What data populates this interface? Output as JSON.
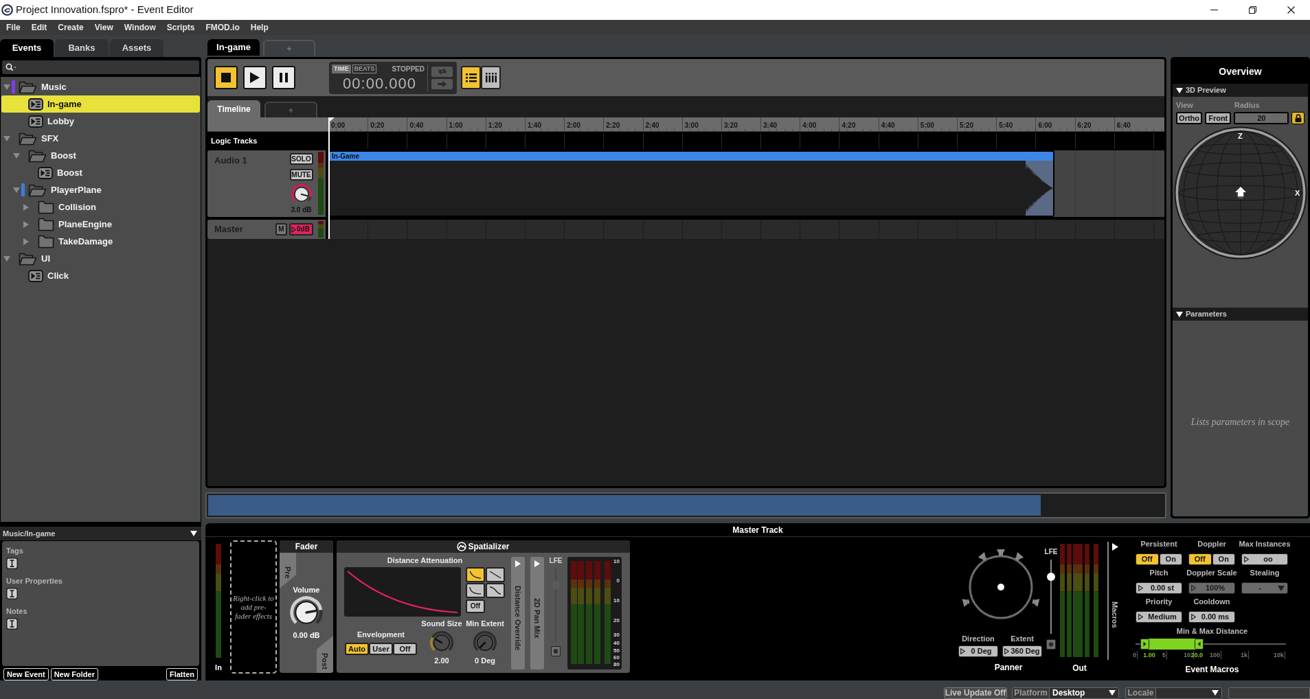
{
  "window": {
    "title": "Project Innovation.fspro* - Event Editor"
  },
  "menu": [
    "File",
    "Edit",
    "Create",
    "View",
    "Window",
    "Scripts",
    "FMOD.io",
    "Help"
  ],
  "browser": {
    "tabs": [
      {
        "label": "Events",
        "selected": true
      },
      {
        "label": "Banks",
        "selected": false
      },
      {
        "label": "Assets",
        "selected": false
      }
    ],
    "tree": [
      {
        "label": "Music",
        "kind": "folder",
        "expanded": true,
        "selected": false,
        "color": "#7c3fe6",
        "children": [
          {
            "label": "In-game",
            "kind": "event",
            "selected": true
          },
          {
            "label": "Lobby",
            "kind": "event",
            "selected": false
          }
        ]
      },
      {
        "label": "SFX",
        "kind": "folder",
        "expanded": true,
        "selected": false,
        "children": [
          {
            "label": "Boost",
            "kind": "folder",
            "expanded": true,
            "selected": false,
            "children": [
              {
                "label": "Boost",
                "kind": "event",
                "selected": false
              }
            ]
          },
          {
            "label": "PlayerPlane",
            "kind": "folder",
            "expanded": true,
            "selected": false,
            "color": "#3a7ce2",
            "children": [
              {
                "label": "Collision",
                "kind": "folder",
                "expanded": false,
                "selected": false
              },
              {
                "label": "PlaneEngine",
                "kind": "folder",
                "expanded": false,
                "selected": false
              },
              {
                "label": "TakeDamage",
                "kind": "folder",
                "expanded": false,
                "selected": false
              }
            ]
          }
        ]
      },
      {
        "label": "UI",
        "kind": "folder",
        "expanded": true,
        "selected": false,
        "children": [
          {
            "label": "Click",
            "kind": "event",
            "selected": false
          }
        ]
      }
    ],
    "inspector": {
      "path": "Music/In-game",
      "sections": [
        "Tags",
        "User Properties",
        "Notes"
      ]
    },
    "buttons": [
      "New Event",
      "New Folder"
    ],
    "flatten": "Flatten"
  },
  "editor": {
    "tabs": [
      {
        "label": "In-game",
        "selected": true
      },
      {
        "label": "+",
        "selected": false
      }
    ],
    "transport": [
      {
        "kind": "stop",
        "selected": true
      },
      {
        "kind": "play",
        "selected": false
      },
      {
        "kind": "pause",
        "selected": false
      }
    ],
    "time_modes": [
      {
        "label": "TIME",
        "selected": true
      },
      {
        "label": "BEATS",
        "selected": false
      }
    ],
    "play_state": "STOPPED",
    "time": "00:00.000",
    "view_modes": [
      {
        "kind": "list",
        "selected": true
      },
      {
        "kind": "grid",
        "selected": false
      }
    ],
    "sheet_tabs": [
      {
        "label": "Timeline",
        "selected": true
      },
      {
        "label": "+",
        "selected": false
      }
    ],
    "ruler": [
      "0:00",
      "0:20",
      "0:40",
      "1:00",
      "1:20",
      "1:40",
      "2:00",
      "2:20",
      "2:40",
      "3:00",
      "3:20",
      "3:40",
      "4:00",
      "4:20",
      "4:40",
      "5:00",
      "5:20",
      "5:40",
      "6:00",
      "6:20",
      "6:40"
    ],
    "logic_tracks": "Logic Tracks",
    "tracks": [
      {
        "kind": "audio",
        "name": "Audio 1",
        "solo": "SOLO",
        "mute": "MUTE",
        "volume": "3.0 dB",
        "instrument": "In-Game"
      },
      {
        "kind": "master",
        "name": "Master",
        "mute": "M",
        "volume": "0dB"
      }
    ]
  },
  "overview": {
    "title": "Overview",
    "preview": {
      "header": "3D Preview",
      "expanded": true,
      "view_label": "View",
      "view_buttons": [
        "Ortho",
        "Front"
      ],
      "radius_label": "Radius",
      "radius": "20",
      "locked": true,
      "axes": [
        "Z",
        "X"
      ]
    },
    "parameters": {
      "header": "Parameters",
      "expanded": true,
      "empty_text": "Lists parameters in scope"
    }
  },
  "deck": {
    "title": "Master Track",
    "input_label": "In",
    "effects_hint": "Right-click to add pre-fader effects",
    "fader": {
      "title": "Fader",
      "pre": "Pre",
      "post": "Post",
      "volume_label": "Volume",
      "volume": "0.00 dB"
    },
    "spatializer": {
      "title": "Spatializer",
      "attenuation_label": "Distance Attenuation",
      "curves": [
        {
          "kind": "logarithmic",
          "selected": true
        },
        {
          "kind": "linear",
          "selected": false
        },
        {
          "kind": "linear-squared",
          "selected": false
        },
        {
          "kind": "inverse-tapered",
          "selected": false
        }
      ],
      "curve_off": "Off",
      "envelopment_label": "Envelopment",
      "envelopment": [
        {
          "label": "Auto",
          "selected": true
        },
        {
          "label": "User",
          "selected": false
        },
        {
          "label": "Off",
          "selected": false
        }
      ],
      "sound_size_label": "Sound Size",
      "sound_size": "2.00",
      "min_extent_label": "Min Extent",
      "min_extent": "0 Deg",
      "side_tabs": [
        "Distance Override",
        "2D Pan Mix"
      ],
      "lfe": {
        "label": "LFE",
        "level": 0.8,
        "disabled": true
      },
      "meter_scale": [
        "10",
        "0",
        "10",
        "20",
        "30",
        "40",
        "50",
        "60",
        "80"
      ]
    },
    "panner": {
      "title": "Panner",
      "direction_label": "Direction",
      "direction": "0 Deg",
      "extent_label": "Extent",
      "extent": "360 Deg",
      "lfe": {
        "label": "LFE",
        "level": 0.8,
        "disabled": false
      }
    },
    "output_label": "Out",
    "macros_tab": "Macros",
    "macros": {
      "title": "Event Macros",
      "fields": [
        {
          "kind": "toggle",
          "label": "Persistent",
          "options": [
            {
              "label": "Off",
              "selected": true
            },
            {
              "label": "On",
              "selected": false
            }
          ]
        },
        {
          "kind": "toggle",
          "label": "Doppler",
          "options": [
            {
              "label": "Off",
              "selected": true
            },
            {
              "label": "On",
              "selected": false
            }
          ]
        },
        {
          "kind": "number",
          "label": "Max Instances",
          "value": "oo",
          "disabled": false
        },
        {
          "kind": "number",
          "label": "Pitch",
          "value": "0.00 st",
          "disabled": false
        },
        {
          "kind": "number",
          "label": "Doppler Scale",
          "value": "100%",
          "disabled": true
        },
        {
          "kind": "dropdown",
          "label": "Stealing",
          "value": "-",
          "disabled": true
        },
        {
          "kind": "number",
          "label": "Priority",
          "value": "Medium",
          "disabled": false
        },
        {
          "kind": "number",
          "label": "Cooldown",
          "value": "0.00 ms",
          "disabled": false
        }
      ],
      "distance": {
        "label": "Min & Max Distance",
        "min": "1.00",
        "max": "20.0",
        "scale": [
          "0",
          "5",
          "10",
          "100",
          "1k",
          "10k"
        ]
      }
    }
  },
  "status_bar": {
    "live_update": "Live Update Off",
    "platform_label": "Platform",
    "platform": "Desktop",
    "locale_label": "Locale"
  }
}
